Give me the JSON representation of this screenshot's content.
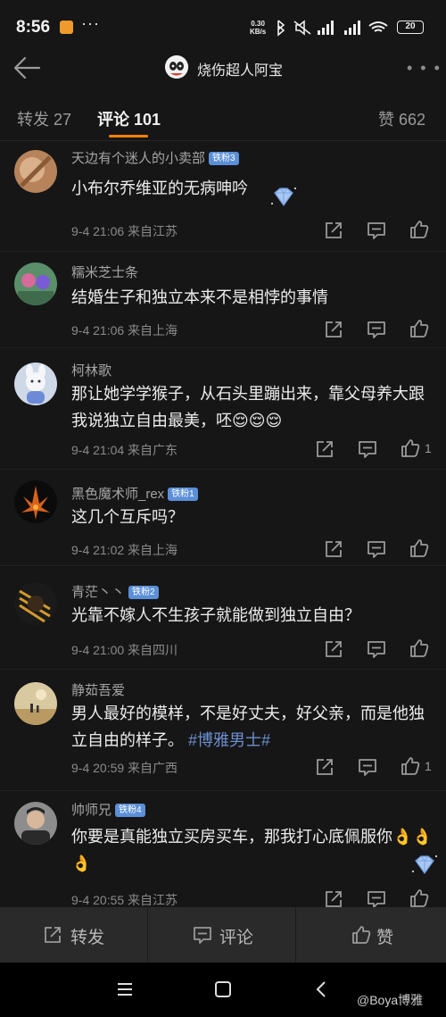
{
  "status_bar": {
    "time": "8:56",
    "net_speed_value": "0.30",
    "net_speed_unit": "KB/s",
    "battery": "20"
  },
  "nav": {
    "title": "烧伤超人阿宝"
  },
  "tabs": [
    {
      "label": "转发 27"
    },
    {
      "label": "评论 101"
    },
    {
      "label": "赞 662"
    }
  ],
  "colors": {
    "background": "#161616",
    "accent": "#ff8200",
    "badge": "#5b8fd8",
    "topic": "#6b8fcf"
  },
  "comments": [
    {
      "name": "天边有个迷人的小卖部",
      "badge": "铁粉3",
      "text": "小布尔乔维亚的无病呻吟",
      "meta": "9-4 21:06  来自江苏",
      "likes": ""
    },
    {
      "name": "糯米芝士条",
      "badge": "",
      "text": "结婚生子和独立本来不是相悖的事情",
      "meta": "9-4 21:06  来自上海",
      "likes": ""
    },
    {
      "name": "柯林歌",
      "badge": "",
      "text": "那让她学学猴子，从石头里蹦出来，靠父母养大跟我说独立自由最美，呸😌😌😌",
      "meta": "9-4 21:04  来自广东",
      "likes": "1"
    },
    {
      "name": "黑色魔术师_rex",
      "badge": "铁粉1",
      "text": "这几个互斥吗？",
      "meta": "9-4 21:02  来自上海",
      "likes": ""
    },
    {
      "name": "青茫丶丶",
      "badge": "铁粉2",
      "text": "光靠不嫁人不生孩子就能做到独立自由？",
      "meta": "9-4 21:00  来自四川",
      "likes": ""
    },
    {
      "name": "静茹吾爱",
      "badge": "",
      "text": "男人最好的模样，不是好丈夫，好父亲，而是他独立自由的样子。",
      "topic": "#博雅男士#",
      "meta": "9-4 20:59  来自广西",
      "likes": "1"
    },
    {
      "name": "帅师兄",
      "badge": "铁粉4",
      "text": "你要是真能独立买房买车，那我打心底佩服你👌👌👌",
      "meta": "9-4 20:55  来自江苏",
      "likes": ""
    }
  ],
  "bottom_bar": {
    "repost": "转发",
    "comment": "评论",
    "like": "赞"
  },
  "watermark": "@Boya博雅"
}
